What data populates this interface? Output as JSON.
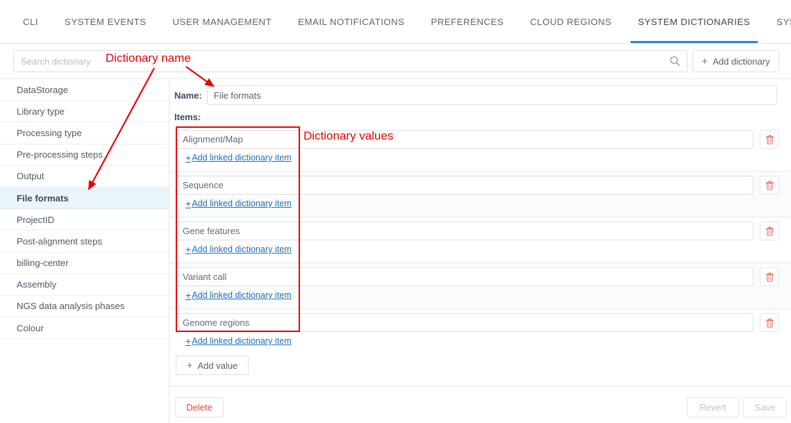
{
  "tabs": [
    {
      "label": "CLI",
      "active": false
    },
    {
      "label": "SYSTEM EVENTS",
      "active": false
    },
    {
      "label": "USER MANAGEMENT",
      "active": false
    },
    {
      "label": "EMAIL NOTIFICATIONS",
      "active": false
    },
    {
      "label": "PREFERENCES",
      "active": false
    },
    {
      "label": "CLOUD REGIONS",
      "active": false
    },
    {
      "label": "SYSTEM DICTIONARIES",
      "active": true
    },
    {
      "label": "SYSTEM LOGS",
      "active": false
    }
  ],
  "toolbar": {
    "search_placeholder": "Search dictionary",
    "search_value": "",
    "search_icon": "search-icon",
    "add_dictionary_label": "Add dictionary",
    "add_dictionary_plus": "+"
  },
  "sidebar": {
    "items": [
      {
        "label": "DataStorage",
        "selected": false
      },
      {
        "label": "Library type",
        "selected": false
      },
      {
        "label": "Processing type",
        "selected": false
      },
      {
        "label": "Pre-processing steps",
        "selected": false
      },
      {
        "label": "Output",
        "selected": false
      },
      {
        "label": "File formats",
        "selected": true
      },
      {
        "label": "ProjectID",
        "selected": false
      },
      {
        "label": "Post-alignment steps",
        "selected": false
      },
      {
        "label": "billing-center",
        "selected": false
      },
      {
        "label": "Assembly",
        "selected": false
      },
      {
        "label": "NGS data analysis phases",
        "selected": false
      },
      {
        "label": "Colour",
        "selected": false
      }
    ]
  },
  "detail": {
    "name_label": "Name:",
    "name_value": "File formats",
    "items_label": "Items:",
    "add_linked_label": "Add linked dictionary item",
    "add_linked_plus": "+",
    "delete_icon": "trash-icon",
    "items": [
      {
        "value": "Alignment/Map"
      },
      {
        "value": "Sequence"
      },
      {
        "value": "Gene features"
      },
      {
        "value": "Variant call"
      },
      {
        "value": "Genome regions"
      }
    ],
    "add_value_label": "Add value",
    "add_value_plus": "+",
    "delete_label": "Delete",
    "revert_label": "Revert",
    "save_label": "Save"
  },
  "annotations": {
    "dictionary_name": "Dictionary name",
    "dictionary_values": "Dictionary values",
    "color": "#ee0000"
  }
}
